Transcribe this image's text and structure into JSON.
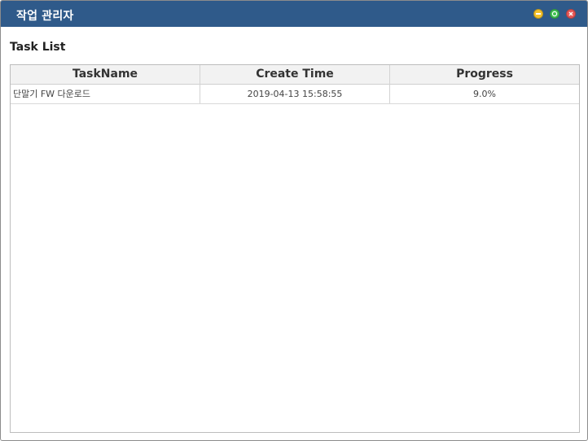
{
  "window": {
    "title": "작업 관리자",
    "controls": [
      {
        "name": "minimize",
        "color": "#f4c22b"
      },
      {
        "name": "restore",
        "color": "#3fbf52"
      },
      {
        "name": "close",
        "color": "#e65757"
      }
    ]
  },
  "section": {
    "title": "Task List"
  },
  "table": {
    "columns": [
      "TaskName",
      "Create Time",
      "Progress"
    ],
    "rows": [
      {
        "task_name": "단말기 FW 다운로드",
        "create_time": "2019-04-13 15:58:55",
        "progress": "9.0%"
      }
    ]
  },
  "colors": {
    "titlebar": "#2f5a8a",
    "header_bg": "#f2f2f2",
    "grid_border": "#bdbdbd"
  }
}
